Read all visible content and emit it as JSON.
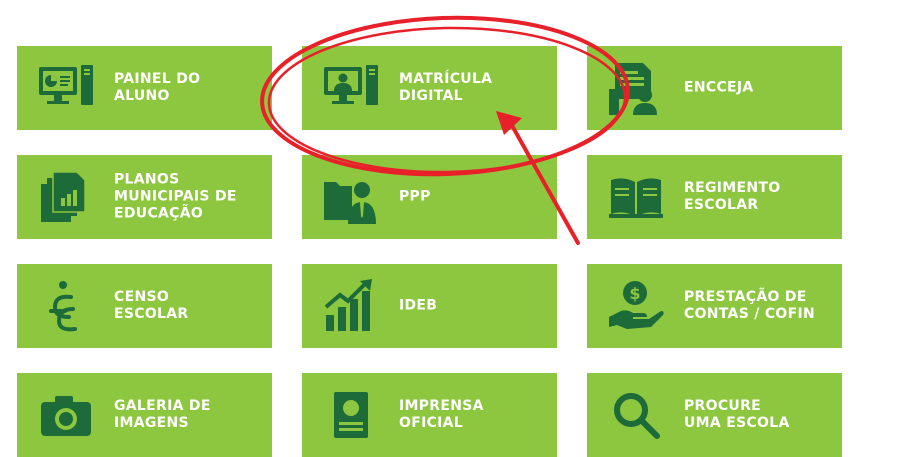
{
  "accent_color": "#8dc63f",
  "icon_color": "#1d6b38",
  "annotation_color": "#e8202a",
  "tiles": [
    {
      "label": "PAINEL DO\nALUNO",
      "icon": "computer-chart-icon"
    },
    {
      "label": "MATRÍCULA\nDIGITAL",
      "icon": "computer-user-icon"
    },
    {
      "label": "ENCCEJA",
      "icon": "document-person-icon"
    },
    {
      "label": "PLANOS\nMUNICIPAIS DE\nEDUCAÇÃO",
      "icon": "documents-chart-icon"
    },
    {
      "label": "PPP",
      "icon": "folder-person-icon"
    },
    {
      "label": "REGIMENTO\nESCOLAR",
      "icon": "open-book-icon"
    },
    {
      "label": "CENSO\nESCOLAR",
      "icon": "census-symbol-icon"
    },
    {
      "label": "IDEB",
      "icon": "bar-chart-arrow-icon"
    },
    {
      "label": "PRESTAÇÃO DE\nCONTAS / COFIN",
      "icon": "hand-coin-icon"
    },
    {
      "label": "GALERIA DE\nIMAGENS",
      "icon": "camera-icon"
    },
    {
      "label": "IMPRENSA\nOFICIAL",
      "icon": "newspaper-icon"
    },
    {
      "label": "PROCURE\nUMA ESCOLA",
      "icon": "magnifier-icon"
    }
  ]
}
